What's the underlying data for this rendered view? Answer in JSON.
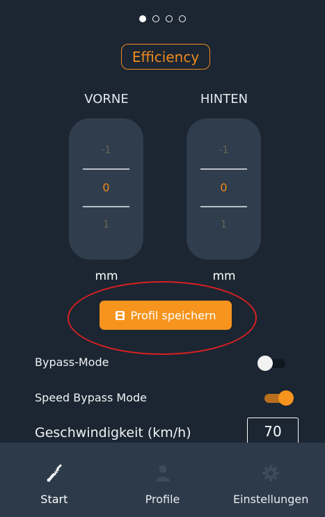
{
  "pager": {
    "count": 4,
    "active_index": 0
  },
  "mode_badge": {
    "label": "Efficiency"
  },
  "columns": {
    "front": {
      "label": "VORNE",
      "values": [
        "-1",
        "0",
        "1"
      ],
      "unit": "mm"
    },
    "rear": {
      "label": "HINTEN",
      "values": [
        "-1",
        "0",
        "1"
      ],
      "unit": "mm"
    }
  },
  "save_button": {
    "label": "Profil speichern",
    "icon": "floppy-disk-icon"
  },
  "settings": {
    "bypass_mode": {
      "label": "Bypass-Mode",
      "enabled": false
    },
    "speed_bypass_mode": {
      "label": "Speed Bypass Mode",
      "enabled": true
    },
    "speed": {
      "label": "Geschwindigkeit (km/h)",
      "value": "70"
    }
  },
  "nav": {
    "items": [
      {
        "label": "Start",
        "icon": "shock-absorber-icon",
        "active": true
      },
      {
        "label": "Profile",
        "icon": "person-icon",
        "active": false
      },
      {
        "label": "Einstellungen",
        "icon": "gear-icon",
        "active": false
      }
    ]
  },
  "colors": {
    "background": "#1b2632",
    "accent": "#f7941d",
    "panel": "#2f3d4c",
    "nav_bg": "#2d3a49",
    "highlight": "#d92020"
  }
}
